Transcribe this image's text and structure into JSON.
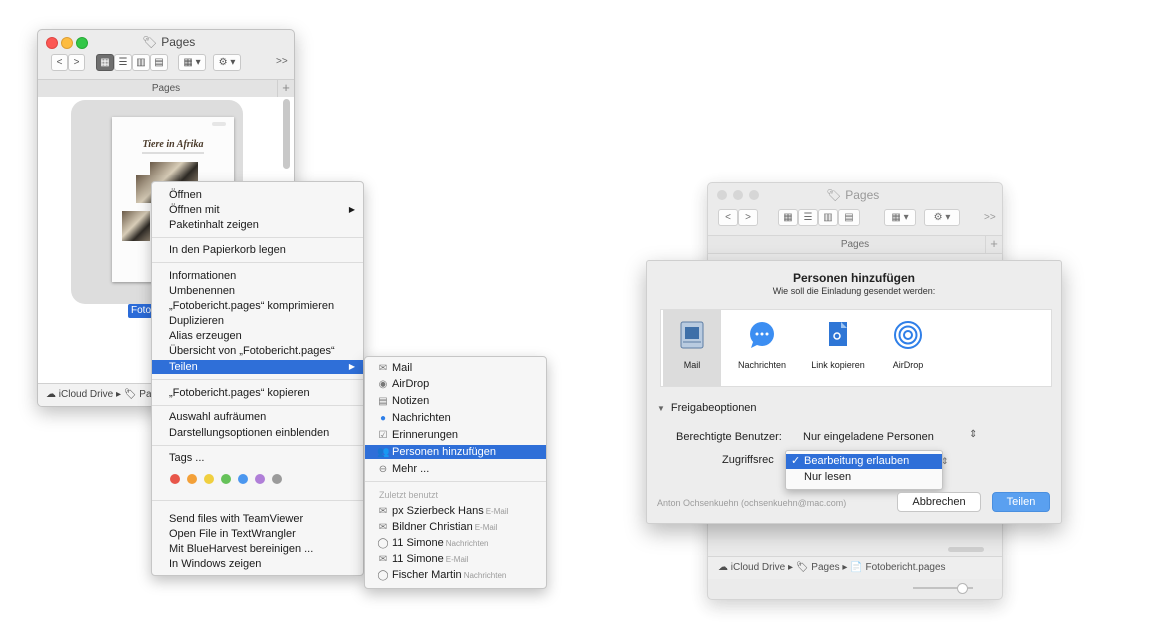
{
  "left_window": {
    "title": "Pages",
    "tab_label": "Pages",
    "tab_plus": "+",
    "toolbar": {
      "back": "<",
      "forward": ">",
      "overflow": ">>"
    },
    "document_title": "Tiere in Afrika",
    "file_label": "Foto",
    "pathbar": "iCloud Drive ▸ 🏷 Pa"
  },
  "context_menu": {
    "items": [
      {
        "label": "Öffnen"
      },
      {
        "label": "Öffnen mit",
        "submenu": true
      },
      {
        "label": "Paketinhalt zeigen"
      },
      {
        "label": "In den Papierkorb legen"
      },
      {
        "label": "Informationen"
      },
      {
        "label": "Umbenennen"
      },
      {
        "label": "„Fotobericht.pages“ komprimieren"
      },
      {
        "label": "Duplizieren"
      },
      {
        "label": "Alias erzeugen"
      },
      {
        "label": "Übersicht von „Fotobericht.pages“"
      },
      {
        "label": "Teilen",
        "submenu": true,
        "highlighted": true
      },
      {
        "label": "„Fotobericht.pages“ kopieren"
      },
      {
        "label": "Auswahl aufräumen"
      },
      {
        "label": "Darstellungsoptionen einblenden"
      },
      {
        "label": "Tags ..."
      },
      {
        "label": "Send files with TeamViewer"
      },
      {
        "label": "Open File in TextWrangler"
      },
      {
        "label": "Mit BlueHarvest bereinigen ..."
      },
      {
        "label": "In Windows zeigen"
      }
    ],
    "tag_colors": [
      "#e8564a",
      "#f3a038",
      "#f0cf3f",
      "#66c25a",
      "#4b97ef",
      "#b07fd8",
      "#9b9b9b"
    ]
  },
  "share_submenu": {
    "items": [
      {
        "label": "Mail",
        "icon": "mail-icon"
      },
      {
        "label": "AirDrop",
        "icon": "airdrop-icon"
      },
      {
        "label": "Notizen",
        "icon": "notes-icon"
      },
      {
        "label": "Nachrichten",
        "icon": "messages-icon"
      },
      {
        "label": "Erinnerungen",
        "icon": "reminders-icon"
      },
      {
        "label": "Personen hinzufügen",
        "icon": "add-people-icon",
        "highlighted": true
      },
      {
        "label": "Mehr ...",
        "icon": "more-icon"
      }
    ],
    "recent_header": "Zuletzt benutzt",
    "recent": [
      {
        "name": "px Szierbeck Hans",
        "via": "E-Mail",
        "icon": "mail-icon"
      },
      {
        "name": "Bildner Christian",
        "via": "E-Mail",
        "icon": "mail-icon"
      },
      {
        "name": "11 Simone",
        "via": "Nachrichten",
        "icon": "message-bubble-icon"
      },
      {
        "name": "11 Simone",
        "via": "E-Mail",
        "icon": "mail-icon"
      },
      {
        "name": "Fischer Martin",
        "via": "Nachrichten",
        "icon": "message-bubble-icon"
      }
    ]
  },
  "right_window": {
    "title": "Pages",
    "tab_label": "Pages",
    "tab_plus": "+",
    "toolbar": {
      "back": "<",
      "forward": ">",
      "overflow": ">>"
    },
    "pathbar": "iCloud Drive ▸ 🏷 Pages ▸ 📄 Fotobericht.pages"
  },
  "sheet": {
    "title": "Personen hinzufügen",
    "subtitle": "Wie soll die Einladung gesendet werden:",
    "share_options": [
      {
        "label": "Mail",
        "icon": "mail-stamp-icon",
        "selected": true
      },
      {
        "label": "Nachrichten",
        "icon": "messages-icon",
        "selected": false
      },
      {
        "label": "Link kopieren",
        "icon": "copy-link-icon",
        "selected": false
      },
      {
        "label": "AirDrop",
        "icon": "airdrop-icon",
        "selected": false
      }
    ],
    "options_header": "Freigabeoptionen",
    "users_label": "Berechtigte Benutzer:",
    "users_value": "Nur eingeladene Personen",
    "access_label": "Zugriffsrec",
    "access_options": [
      {
        "label": "Bearbeitung erlauben",
        "checked": true
      },
      {
        "label": "Nur lesen",
        "checked": false
      }
    ],
    "owner": "Anton Ochsenkuehn (ochsenkuehn@mac.com)",
    "cancel_label": "Abbrechen",
    "share_label": "Teilen"
  }
}
